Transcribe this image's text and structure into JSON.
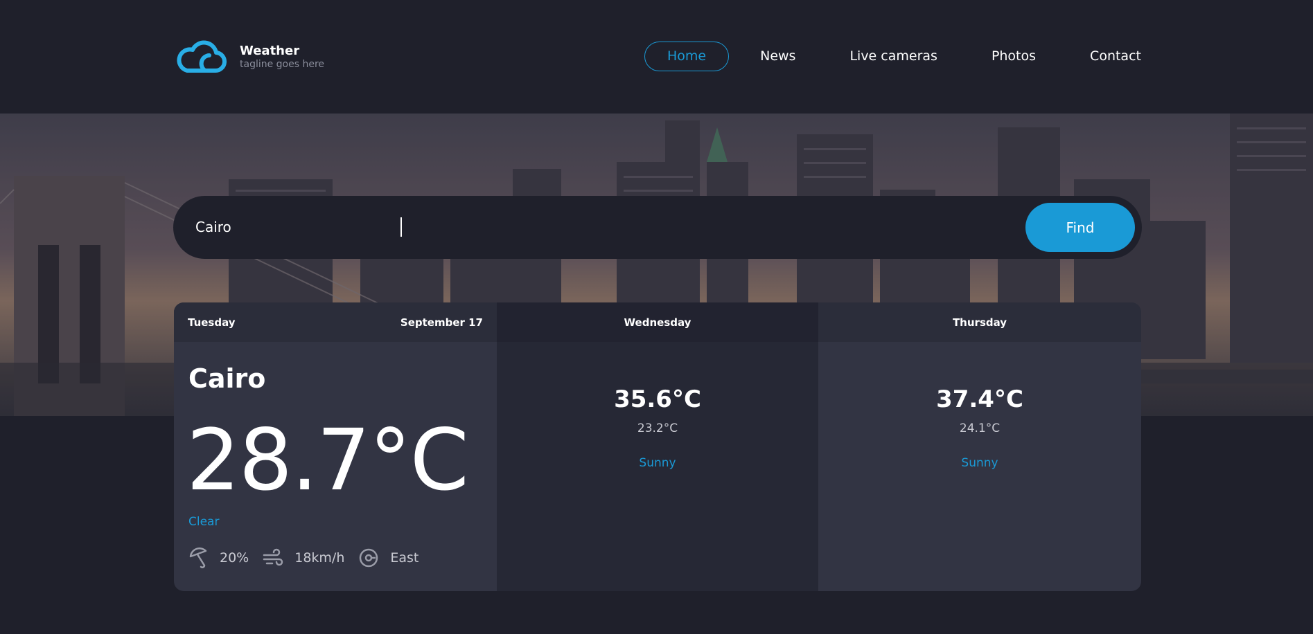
{
  "brand": {
    "title": "Weather",
    "tagline": "tagline goes here",
    "logo_icon": "cloud-icon"
  },
  "nav": {
    "items": [
      {
        "label": "Home",
        "active": true
      },
      {
        "label": "News",
        "active": false
      },
      {
        "label": "Live cameras",
        "active": false
      },
      {
        "label": "Photos",
        "active": false
      },
      {
        "label": "Contact",
        "active": false
      }
    ]
  },
  "search": {
    "value": "Cairo",
    "button_label": "Find"
  },
  "forecast": {
    "today": {
      "day": "Tuesday",
      "date": "September 17",
      "city": "Cairo",
      "temperature": "28.7°C",
      "condition": "Clear",
      "humidity": "20%",
      "wind_speed": "18km/h",
      "wind_direction": "East",
      "icons": [
        "umbrella-icon",
        "wind-icon",
        "compass-icon"
      ]
    },
    "days": [
      {
        "day": "Wednesday",
        "max": "35.6°C",
        "min": "23.2°C",
        "condition": "Sunny"
      },
      {
        "day": "Thursday",
        "max": "37.4°C",
        "min": "24.1°C",
        "condition": "Sunny"
      }
    ]
  },
  "colors": {
    "background": "#1f202b",
    "accent": "#1a9ad6",
    "panel": "#323443",
    "panel_alt": "#262835"
  }
}
